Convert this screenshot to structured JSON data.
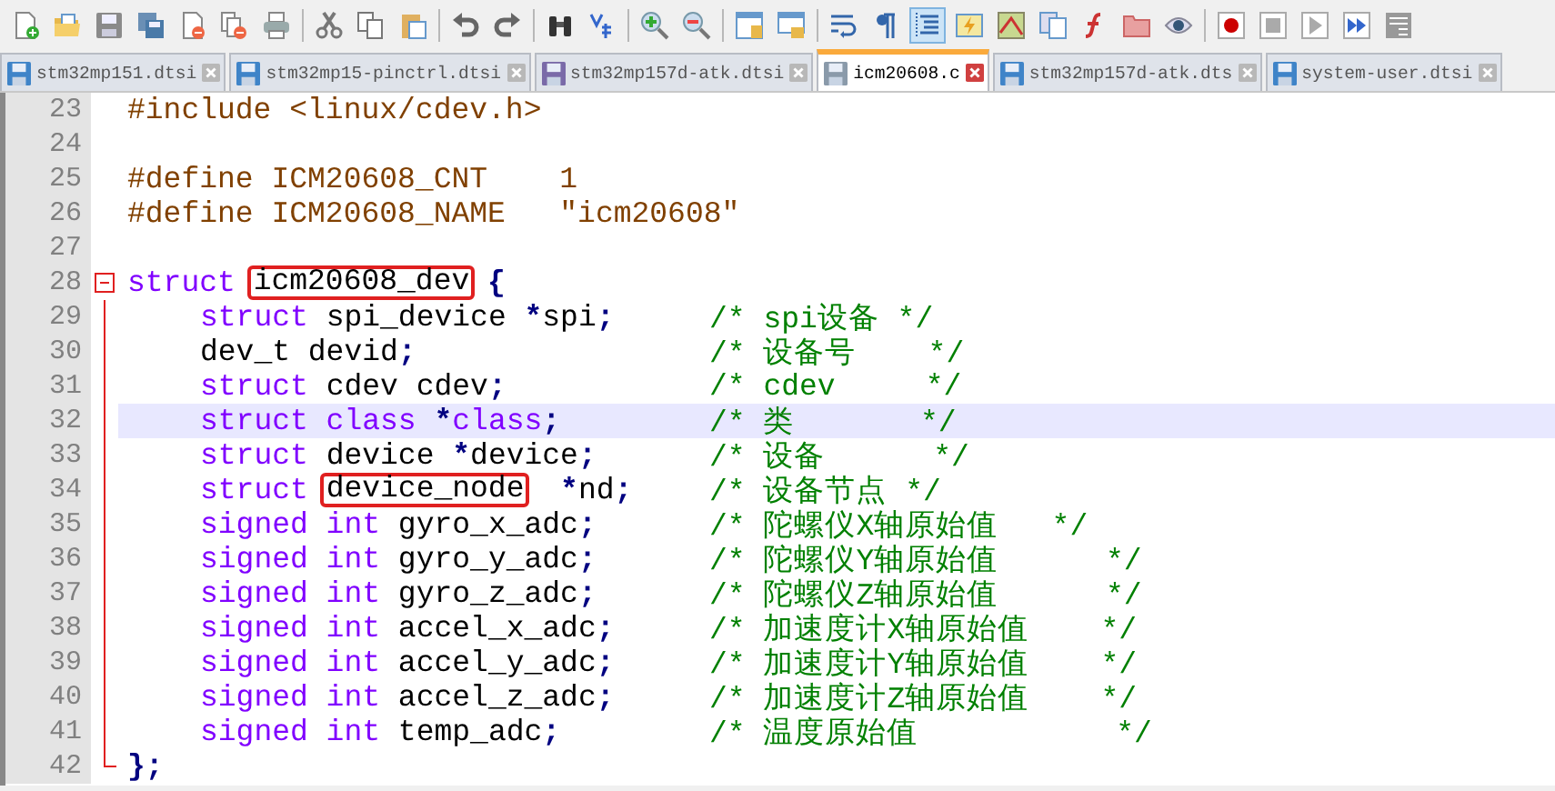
{
  "toolbar": [
    {
      "pressed": false
    },
    {
      "pressed": false
    },
    {
      "pressed": false
    },
    {
      "pressed": false
    },
    {
      "pressed": false
    },
    {
      "pressed": false
    },
    {
      "pressed": false
    },
    {
      "pressed": false
    },
    {
      "pressed": false
    },
    {
      "pressed": false
    },
    {
      "pressed": false
    },
    {
      "pressed": false
    },
    {
      "pressed": false
    },
    {
      "pressed": false
    },
    {
      "pressed": false
    },
    {
      "pressed": false
    },
    {
      "pressed": false
    },
    {
      "pressed": false
    },
    {
      "pressed": false
    },
    {
      "pressed": false
    },
    {
      "pressed": true
    },
    {
      "pressed": false
    },
    {
      "pressed": false
    },
    {
      "pressed": false
    },
    {
      "pressed": false
    },
    {
      "pressed": false
    },
    {
      "pressed": false
    },
    {
      "pressed": false
    },
    {
      "pressed": false
    },
    {
      "pressed": false
    },
    {
      "pressed": false
    },
    {
      "pressed": false
    }
  ],
  "tabs": [
    {
      "label": "stm32mp151.dtsi",
      "selected": false,
      "readonly": false
    },
    {
      "label": "stm32mp15-pinctrl.dtsi",
      "selected": false,
      "readonly": false
    },
    {
      "label": "stm32mp157d-atk.dtsi",
      "selected": false,
      "readonly": true
    },
    {
      "label": "icm20608.c",
      "selected": true,
      "readonly": false
    },
    {
      "label": "stm32mp157d-atk.dts",
      "selected": false,
      "readonly": false
    },
    {
      "label": "system-user.dtsi",
      "selected": false,
      "readonly": false
    }
  ],
  "lines": [
    {
      "number": "23",
      "current": false,
      "kind": "top",
      "code": [
        {
          "kind": "pre",
          "text": "#include <linux/cdev.h>"
        }
      ]
    },
    {
      "number": "24",
      "current": false,
      "kind": "top"
    },
    {
      "number": "25",
      "current": false,
      "kind": "top",
      "code": [
        {
          "kind": "pre",
          "text": "#define ICM20608_CNT    1"
        }
      ]
    },
    {
      "number": "26",
      "current": false,
      "kind": "top",
      "code": [
        {
          "kind": "pre",
          "text": "#define ICM20608_NAME   \"icm20608\""
        }
      ]
    },
    {
      "number": "27",
      "current": false,
      "kind": "top"
    },
    {
      "number": "28",
      "current": false,
      "kind": "foldstart",
      "code": [
        {
          "kind": "kw",
          "text": "struct "
        },
        {
          "kind": "boxed",
          "text": "icm20608_dev"
        },
        {
          "kind": "op",
          "text": " {"
        }
      ]
    },
    {
      "number": "29",
      "current": false,
      "kind": "foldbody",
      "code": [
        {
          "kind": "kw",
          "text": "struct"
        },
        {
          "kind": "plain",
          "text": " spi_device "
        },
        {
          "kind": "op",
          "text": "*"
        },
        {
          "kind": "plain",
          "text": "spi"
        },
        {
          "kind": "op",
          "text": ";"
        }
      ],
      "comment": "/* spi设备 */"
    },
    {
      "number": "30",
      "current": false,
      "kind": "foldbody",
      "code": [
        {
          "kind": "plain",
          "text": "dev_t devid"
        },
        {
          "kind": "op",
          "text": ";"
        }
      ],
      "comment": "/* 设备号    */"
    },
    {
      "number": "31",
      "current": false,
      "kind": "foldbody",
      "code": [
        {
          "kind": "kw",
          "text": "struct"
        },
        {
          "kind": "plain",
          "text": " cdev cdev"
        },
        {
          "kind": "op",
          "text": ";"
        }
      ],
      "comment": "/* cdev     */"
    },
    {
      "number": "32",
      "current": true,
      "kind": "foldbody",
      "code": [
        {
          "kind": "kw",
          "text": "struct class"
        },
        {
          "kind": "op",
          "text": " *"
        },
        {
          "kind": "kw",
          "text": "class"
        },
        {
          "kind": "op",
          "text": ";"
        }
      ],
      "comment": "/* 类       */"
    },
    {
      "number": "33",
      "current": false,
      "kind": "foldbody",
      "code": [
        {
          "kind": "kw",
          "text": "struct"
        },
        {
          "kind": "plain",
          "text": " device "
        },
        {
          "kind": "op",
          "text": "*"
        },
        {
          "kind": "plain",
          "text": "device"
        },
        {
          "kind": "op",
          "text": ";"
        }
      ],
      "comment": "/* 设备      */"
    },
    {
      "number": "34",
      "current": false,
      "kind": "foldbody",
      "code": [
        {
          "kind": "kw",
          "text": "struct "
        },
        {
          "kind": "boxed",
          "text": "device_node"
        },
        {
          "kind": "op",
          "text": "  *"
        },
        {
          "kind": "plain",
          "text": "nd"
        },
        {
          "kind": "op",
          "text": ";"
        }
      ],
      "comment": "/* 设备节点 */"
    },
    {
      "number": "35",
      "current": false,
      "kind": "foldbody",
      "code": [
        {
          "kind": "kw",
          "text": "signed int"
        },
        {
          "kind": "plain",
          "text": " gyro_x_adc"
        },
        {
          "kind": "op",
          "text": ";"
        }
      ],
      "comment": "/* 陀螺仪X轴原始值   */"
    },
    {
      "number": "36",
      "current": false,
      "kind": "foldbody",
      "code": [
        {
          "kind": "kw",
          "text": "signed int"
        },
        {
          "kind": "plain",
          "text": " gyro_y_adc"
        },
        {
          "kind": "op",
          "text": ";"
        }
      ],
      "comment": "/* 陀螺仪Y轴原始值      */"
    },
    {
      "number": "37",
      "current": false,
      "kind": "foldbody",
      "code": [
        {
          "kind": "kw",
          "text": "signed int"
        },
        {
          "kind": "plain",
          "text": " gyro_z_adc"
        },
        {
          "kind": "op",
          "text": ";"
        }
      ],
      "comment": "/* 陀螺仪Z轴原始值      */"
    },
    {
      "number": "38",
      "current": false,
      "kind": "foldbody",
      "code": [
        {
          "kind": "kw",
          "text": "signed int"
        },
        {
          "kind": "plain",
          "text": " accel_x_adc"
        },
        {
          "kind": "op",
          "text": ";"
        }
      ],
      "comment": "/* 加速度计X轴原始值    */"
    },
    {
      "number": "39",
      "current": false,
      "kind": "foldbody",
      "code": [
        {
          "kind": "kw",
          "text": "signed int"
        },
        {
          "kind": "plain",
          "text": " accel_y_adc"
        },
        {
          "kind": "op",
          "text": ";"
        }
      ],
      "comment": "/* 加速度计Y轴原始值    */"
    },
    {
      "number": "40",
      "current": false,
      "kind": "foldbody",
      "code": [
        {
          "kind": "kw",
          "text": "signed int"
        },
        {
          "kind": "plain",
          "text": " accel_z_adc"
        },
        {
          "kind": "op",
          "text": ";"
        }
      ],
      "comment": "/* 加速度计Z轴原始值    */"
    },
    {
      "number": "41",
      "current": false,
      "kind": "foldbody",
      "code": [
        {
          "kind": "kw",
          "text": "signed int"
        },
        {
          "kind": "plain",
          "text": " temp_adc"
        },
        {
          "kind": "op",
          "text": ";"
        }
      ],
      "comment": "/* 温度原始值           */"
    },
    {
      "number": "42",
      "current": false,
      "kind": "foldend",
      "code": [
        {
          "kind": "op",
          "text": "};"
        }
      ]
    }
  ]
}
